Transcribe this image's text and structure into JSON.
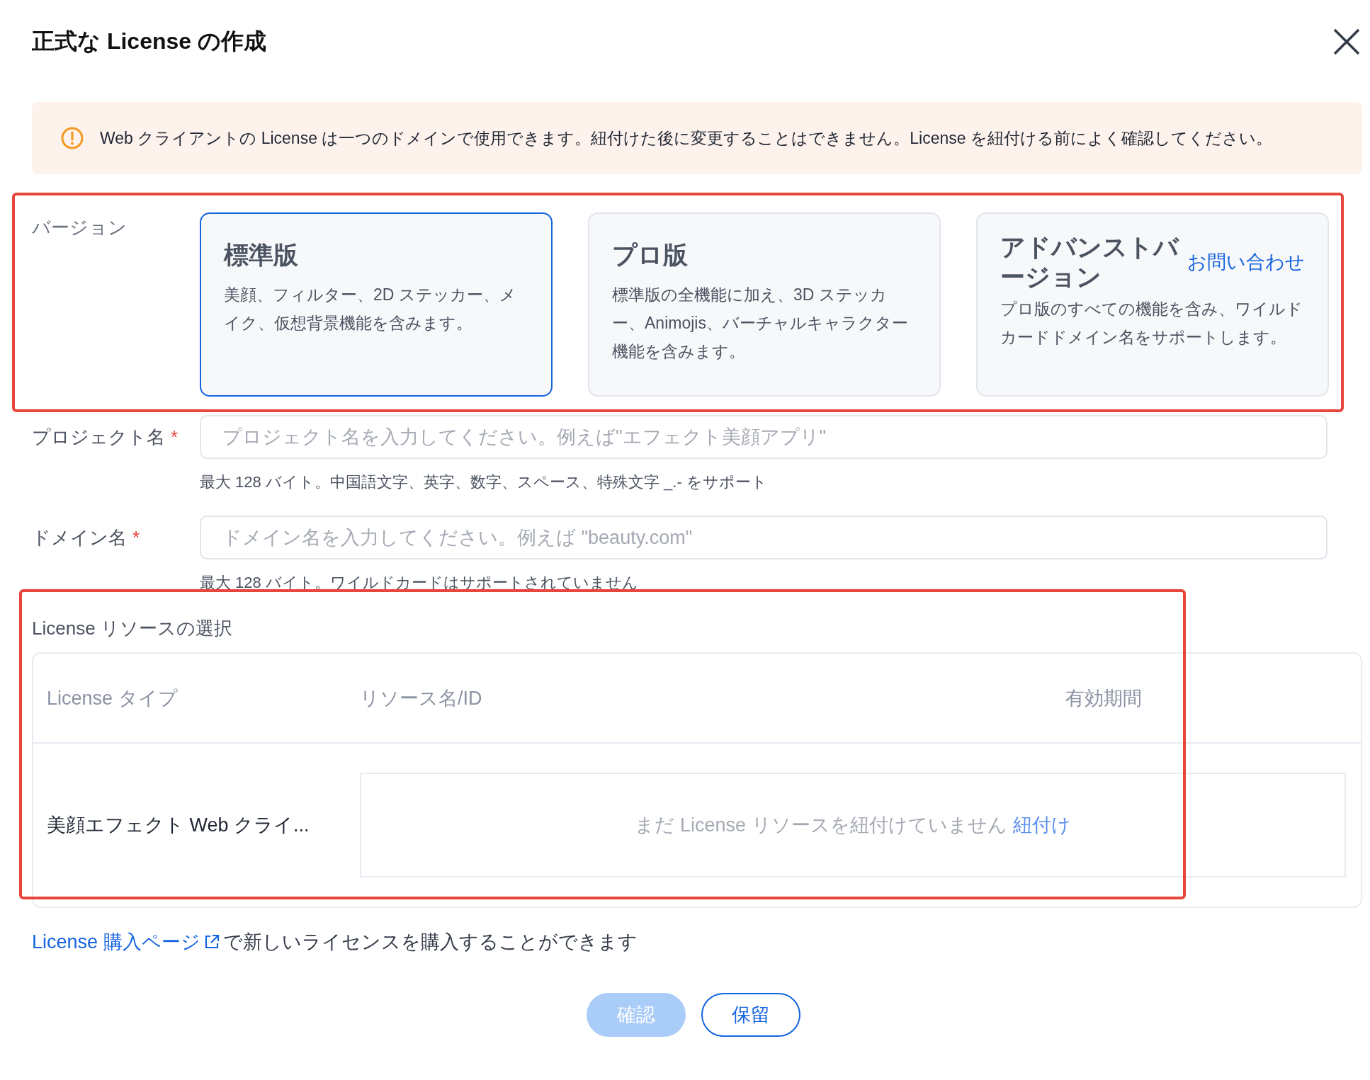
{
  "dialog": {
    "title": "正式な License の作成"
  },
  "alert": {
    "text": "Web クライアントの License は一つのドメインで使用できます。紐付けた後に変更することはできません。License を紐付ける前によく確認してください。"
  },
  "version": {
    "label": "バージョン",
    "highlighted": true,
    "options": [
      {
        "title": "標準版",
        "description": "美顔、フィルター、2D ステッカー、メイク、仮想背景機能を含みます。",
        "selected": true
      },
      {
        "title": "プロ版",
        "description": "標準版の全機能に加え、3D ステッカー、Animojis、バーチャルキャラクター機能を含みます。",
        "selected": false
      },
      {
        "title": "アドバンストバージョン",
        "link": "お問い合わせ",
        "description": "プロ版のすべての機能を含み、ワイルドカードドメイン名をサポートします。",
        "selected": false
      }
    ]
  },
  "fields": [
    {
      "label": "プロジェクト名",
      "required_mark": "*",
      "placeholder": "プロジェクト名を入力してください。例えば\"エフェクト美顔アプリ\"",
      "hint": "最大 128 バイト。中国語文字、英字、数字、スペース、特殊文字 _.- をサポート"
    },
    {
      "label": "ドメイン名",
      "required_mark": "*",
      "placeholder": "ドメイン名を入力してください。例えば \"beauty.com\"",
      "hint": "最大 128 バイト。ワイルドカードはサポートされていません"
    }
  ],
  "resources": {
    "title": "License リソースの選択",
    "highlighted": true,
    "columns": [
      "License タイプ",
      "リソース名/ID",
      "有効期間"
    ],
    "rows": [
      {
        "license_type": "美顔エフェクト Web クライ...",
        "empty_text": "まだ License リソースを紐付けていません",
        "bind_link": "紐付け"
      }
    ]
  },
  "purchase": {
    "link": "License 購入ページ",
    "text": "で新しいライセンスを購入することができます"
  },
  "buttons": [
    {
      "label": "確認",
      "kind": "primary",
      "disabled": true
    },
    {
      "label": "保留",
      "kind": "secondary",
      "disabled": false
    }
  ]
}
